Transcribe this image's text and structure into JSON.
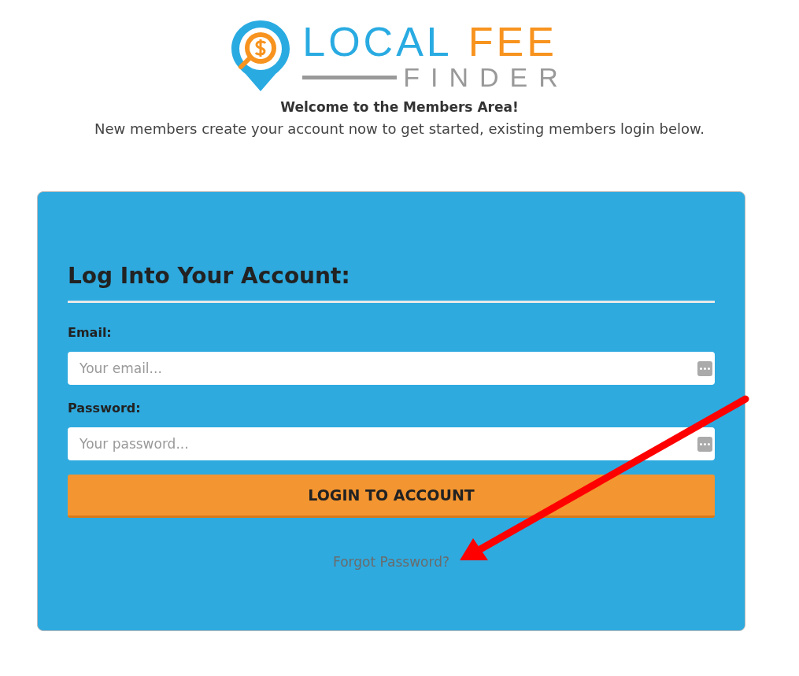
{
  "logo": {
    "word_1": "LOCAL",
    "word_2": "FEE",
    "word_3": "FINDER"
  },
  "welcome": {
    "title": "Welcome to the Members Area!",
    "subtitle": "New members create your account now to get started, existing members login below."
  },
  "login_card": {
    "heading": "Log Into Your Account:",
    "fields": [
      {
        "label": "Email:",
        "placeholder": "Your email..."
      },
      {
        "label": "Password:",
        "placeholder": "Your password..."
      }
    ],
    "button": "LOGIN TO ACCOUNT",
    "link": "Forgot Password?"
  }
}
